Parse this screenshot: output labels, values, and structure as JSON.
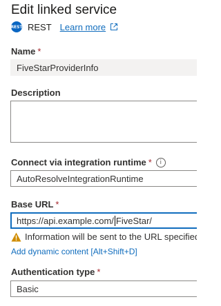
{
  "header": {
    "title": "Edit linked service",
    "service_type": "REST",
    "learn_more": "Learn more",
    "rest_icon_text": "REST"
  },
  "name": {
    "label": "Name",
    "required": "*",
    "value": "FiveStarProviderInfo"
  },
  "description": {
    "label": "Description",
    "value": ""
  },
  "integration_runtime": {
    "label": "Connect via integration runtime",
    "required": "*",
    "value": "AutoResolveIntegrationRuntime"
  },
  "base_url": {
    "label": "Base URL",
    "required": "*",
    "value_before_caret": "https://api.example.com/",
    "value_after_caret": "FiveStar/",
    "warning": "Information will be sent to the URL specified",
    "dynamic_content_link": "Add dynamic content [Alt+Shift+D]"
  },
  "authentication": {
    "label": "Authentication type",
    "required": "*",
    "value": "Basic"
  },
  "colors": {
    "link": "#0f6cbd",
    "required": "#a4262c",
    "warning": "#d08c00",
    "focus_border": "#0f6cbd"
  }
}
